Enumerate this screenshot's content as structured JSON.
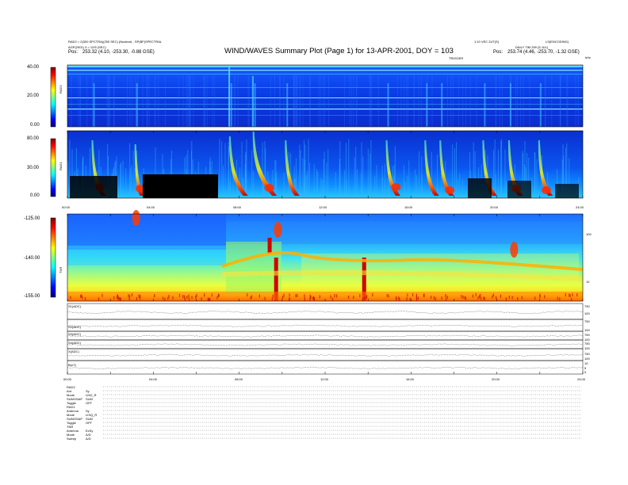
{
  "header": {
    "title": "WIND/WAVES Summary Plot (Page 1) for 13-APR-2001, DOY = 103",
    "left_line1": "RAD2 = 2(300 SPCTRA)(250 SEC) (Nuclear) - SP(BF)SPECTRAL",
    "left_line2": "AGP(2001) 3 = 12/5 (SEC)",
    "left_pos": "Pos:",
    "left_pos_value": "253.32 (4.10, -253.30, -0.88 GSE)",
    "right_line1": "1:10 VEC 2UT(S)",
    "right_line2": "LS(ENCODING)",
    "right_line3": "DAILY TIM 259 (5 JUL)",
    "right_pos": "Pos:",
    "right_pos_value": "253.74 (4.46, -253.70, -1.32 GSE)",
    "right_tiny1": "TRIGGER",
    "right_tiny2": "kHz"
  },
  "colors": {
    "cbar": [
      "#7f0000",
      "#ff0000",
      "#ff8000",
      "#ffff00",
      "#80ff80",
      "#00ffff",
      "#0080ff",
      "#0000ff",
      "#00007f"
    ],
    "fill_black": "#000000",
    "dots": "#555555"
  },
  "chart_data": [
    {
      "type": "heatmap",
      "panel": "RAD2",
      "ylabel": "RAD2",
      "yticks": [
        "40.00",
        "20.00",
        "0.00"
      ],
      "ylim": [
        0,
        40
      ],
      "xlim_hours": [
        0,
        24
      ],
      "bursts_hours": [
        1.2,
        3.2,
        7.6,
        8.7,
        10.2,
        14.9,
        16.7,
        17.4,
        19.4,
        20.6,
        22.0
      ]
    },
    {
      "type": "heatmap",
      "panel": "RAD1",
      "ylabel": "RAD1",
      "yticks": [
        "80.00",
        "30.00",
        "0.00"
      ],
      "ylim": [
        0,
        80
      ],
      "xticks": [
        "00:00",
        "04:00",
        "08:00",
        "12:00",
        "16:00",
        "20:00",
        "24:00"
      ],
      "bursts_hours": [
        1.2,
        3.2,
        7.6,
        8.7,
        10.2,
        14.9,
        16.7,
        17.4,
        19.4,
        20.6,
        22.0
      ]
    },
    {
      "type": "heatmap",
      "panel": "TNR",
      "ylabel": "TNR",
      "yticks": [
        "-125.00",
        "-140.00",
        "-155.00"
      ],
      "right_ticks": [
        "100",
        "10"
      ],
      "ylim": [
        -155,
        -125
      ]
    },
    {
      "type": "line",
      "panel": "time-series",
      "rows": [
        {
          "label": "S1(ADC)",
          "ticks": [
            "750",
            "100"
          ]
        },
        {
          "label": "S2(ADC)",
          "ticks": [
            "750",
            "100"
          ]
        },
        {
          "label": "S3(ADC)",
          "ticks": [
            "750",
            "100"
          ]
        },
        {
          "label": "S4(ADC)",
          "ticks": [
            "750",
            "100"
          ]
        },
        {
          "label": "X(ADC)",
          "ticks": [
            "750",
            "100"
          ]
        },
        {
          "label": "B(nT)",
          "ticks": [
            "10",
            "5",
            "0"
          ]
        }
      ],
      "xticks": [
        "00:00",
        "04:00",
        "08:00",
        "12:00",
        "16:00",
        "20:00",
        "24:00"
      ]
    }
  ],
  "status": {
    "rad2": {
      "title": "RAD2",
      "rows": [
        [
          "Ant",
          "Sy"
        ],
        [
          "Mode",
          "LIN2_R"
        ],
        [
          "SUMOSAP",
          "SUM"
        ],
        [
          "Toggle",
          "OFF"
        ]
      ]
    },
    "rad1": {
      "title": "RAD1",
      "rows": [
        [
          "Antenna",
          "Sy"
        ],
        [
          "Mode",
          "LISQ_R"
        ],
        [
          "SUMOSAP",
          "SUM"
        ],
        [
          "Toggle",
          "OFF"
        ]
      ]
    },
    "tnr": {
      "title": "TNR",
      "rows": [
        [
          "Antenna",
          "ExSy"
        ],
        [
          "Mode",
          "A/D"
        ],
        [
          "Sweep",
          "A/D"
        ]
      ]
    }
  }
}
